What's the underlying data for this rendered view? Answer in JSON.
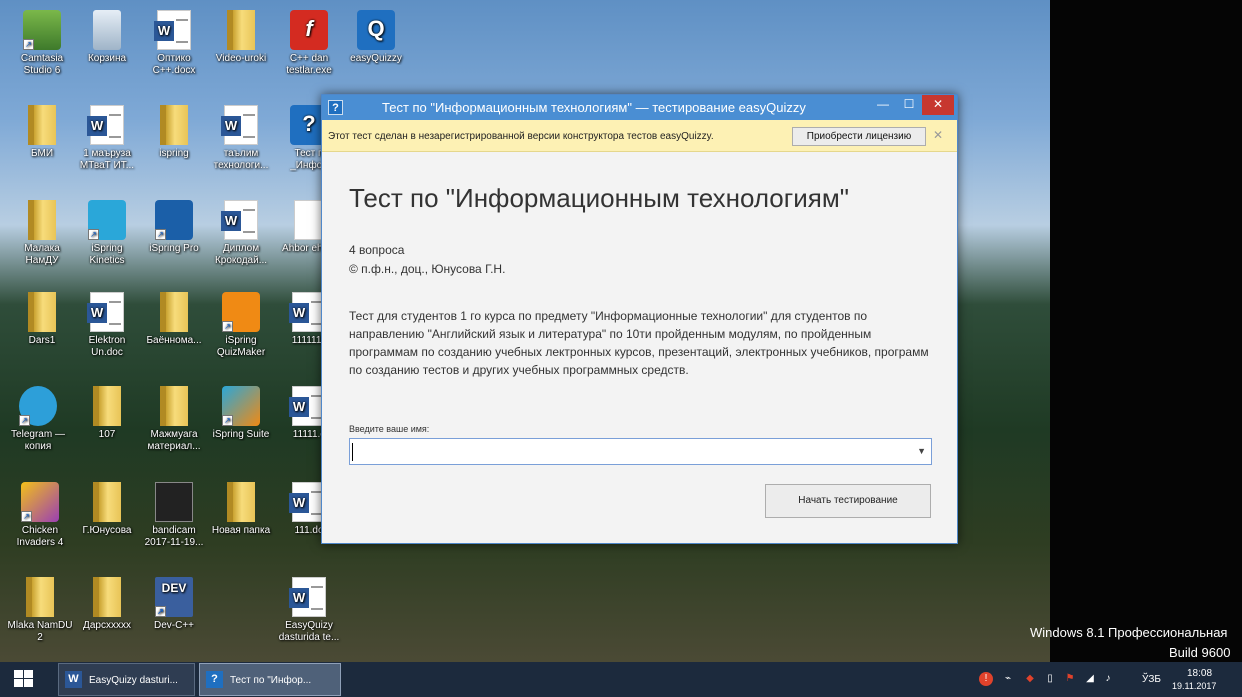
{
  "desktop_icons": [
    {
      "label": "Camtasia Studio 6",
      "icon": "camtasia-icon"
    },
    {
      "label": "Корзина",
      "icon": "recycle-bin-icon"
    },
    {
      "label": "Оптико C++.docx",
      "icon": "word-doc-icon"
    },
    {
      "label": "Video-uroki",
      "icon": "folder-icon"
    },
    {
      "label": "C++ dan testlar.exe",
      "icon": "flash-icon"
    },
    {
      "label": "easyQuizzy",
      "icon": "easyquizzy-icon"
    },
    {
      "label": "БМИ",
      "icon": "folder-icon"
    },
    {
      "label": "1 маъруза МТваТ ИТ...",
      "icon": "word-doc-icon"
    },
    {
      "label": "ispring",
      "icon": "folder-icon"
    },
    {
      "label": "таълим технологи...",
      "icon": "word-doc-icon"
    },
    {
      "label": "Тест п _Инфор",
      "icon": "easyquizzy-icon"
    },
    {
      "label": "Малака НамДУ",
      "icon": "folder-icon"
    },
    {
      "label": "iSpring Kinetics",
      "icon": "ispring-kinetics-icon"
    },
    {
      "label": "iSpring Pro",
      "icon": "ispring-pro-icon"
    },
    {
      "label": "Диплом Крокодай...",
      "icon": "word-doc-icon"
    },
    {
      "label": "Ahbor ehnol",
      "icon": "document-icon"
    },
    {
      "label": "Dars1",
      "icon": "folder-icon"
    },
    {
      "label": "Elektron Un.doc",
      "icon": "word-doc-icon"
    },
    {
      "label": "Баённома...",
      "icon": "folder-icon"
    },
    {
      "label": "iSpring QuizMaker",
      "icon": "ispring-quizmaker-icon"
    },
    {
      "label": "1111111",
      "icon": "word-doc-icon"
    },
    {
      "label": "Telegram — копия",
      "icon": "telegram-icon"
    },
    {
      "label": "107",
      "icon": "folder-icon"
    },
    {
      "label": "Мажмуага материал...",
      "icon": "folder-icon"
    },
    {
      "label": "iSpring Suite",
      "icon": "ispring-suite-icon"
    },
    {
      "label": "11111.c",
      "icon": "word-doc-icon"
    },
    {
      "label": "Chicken Invaders 4",
      "icon": "chicken-invaders-icon"
    },
    {
      "label": "Г.Юнусова",
      "icon": "folder-icon"
    },
    {
      "label": "bandicam 2017-11-19...",
      "icon": "bandicam-icon"
    },
    {
      "label": "Новая папка",
      "icon": "folder-icon"
    },
    {
      "label": "111.do",
      "icon": "word-doc-icon"
    },
    {
      "label": "Mlaka NamDU 2",
      "icon": "folder-icon"
    },
    {
      "label": "Дарсxxxxx",
      "icon": "folder-icon"
    },
    {
      "label": "Dev-C++",
      "icon": "devcpp-icon"
    },
    {
      "label": "EasyQuizy dasturida te...",
      "icon": "word-doc-icon"
    }
  ],
  "dialog": {
    "title": "Тест по \"Информационным технологиям\" — тестирование easyQuizzy",
    "notice": "Этот тест сделан в незарегистрированной версии конструктора тестов easyQuizzy.",
    "license_button": "Приобрести лицензию",
    "test_title": "Тест по \"Информационным технологиям\"",
    "question_count": "4 вопроса",
    "author": "© п.ф.н., доц., Юнусова Г.Н.",
    "description": "Тест для студентов 1 го курса по предмету \"Информационные технологии\" для студентов по направлению \"Английский язык и литература\" по 10ти пройденным модулям, по пройденным программам по созданию учебных  лектронных курсов, презентаций, электронных учебников, программ по созданию тестов и других учебных программных средств.",
    "name_label": "Введите ваше имя:",
    "name_value": "",
    "start_button": "Начать тестирование"
  },
  "taskbar": {
    "items": [
      {
        "label": "EasyQuizy dasturi...",
        "icon": "word-doc-icon"
      },
      {
        "label": "Тест по \"Инфор...",
        "icon": "easyquizzy-icon"
      }
    ],
    "language": "ЎЗБ",
    "time": "18:08",
    "date": "19.11.2017"
  },
  "watermark": {
    "line1": "Windows 8.1 Профессиональная",
    "line2": "Build 9600"
  },
  "colors": {
    "titlebar": "#4a8ed3",
    "close": "#c7372f",
    "notice": "#fdf1b4",
    "taskbar": "#1c2a3d"
  }
}
